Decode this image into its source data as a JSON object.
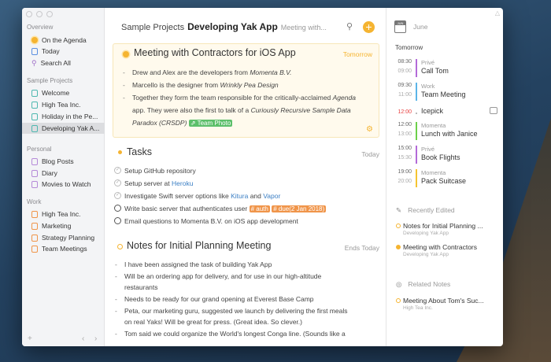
{
  "sidebar": {
    "overview": {
      "title": "Overview",
      "items": [
        {
          "label": "On the Agenda",
          "icon": "agenda-dot-icon"
        },
        {
          "label": "Today",
          "icon": "calendar-icon"
        },
        {
          "label": "Search All",
          "icon": "search-icon"
        }
      ]
    },
    "sample_projects": {
      "title": "Sample Projects",
      "items": [
        {
          "label": "Welcome"
        },
        {
          "label": "High Tea Inc."
        },
        {
          "label": "Holiday in the Pe..."
        },
        {
          "label": "Developing Yak A...",
          "selected": true
        }
      ]
    },
    "personal": {
      "title": "Personal",
      "items": [
        {
          "label": "Blog Posts"
        },
        {
          "label": "Diary"
        },
        {
          "label": "Movies to Watch"
        }
      ]
    },
    "work": {
      "title": "Work",
      "items": [
        {
          "label": "High Tea Inc."
        },
        {
          "label": "Marketing"
        },
        {
          "label": "Strategy Planning"
        },
        {
          "label": "Team Meetings"
        }
      ]
    },
    "footer": {
      "add": "+",
      "back": "‹",
      "forward": "›"
    }
  },
  "header": {
    "category": "Sample Projects",
    "project": "Developing Yak App",
    "note": "Meeting with..."
  },
  "meeting": {
    "title": "Meeting with Contractors for iOS App",
    "when": "Tomorrow",
    "b1": "Drew and Alex are the developers from ",
    "b1i": "Momenta B.V.",
    "b2": "Marcello is the designer from ",
    "b2i": "Wrinkly Pea Design",
    "b3a": "Together they form the team responsible for the critically-acclaimed ",
    "b3i": "Agenda",
    "b3b": "app. They were also the first to talk of a ",
    "b3i2": "Curiously Recursive Sample Data",
    "b3c": "Paradox (CRSDP)",
    "tag": "⇗ Team Photo"
  },
  "tasks": {
    "title": "Tasks",
    "when": "Today",
    "t1": "Setup GitHub repository",
    "t2": "Setup server at ",
    "t2l": "Heroku",
    "t3": "Investigate Swift server options like ",
    "t3l1": "Kitura",
    "t3m": " and ",
    "t3l2": "Vapor",
    "t4": "Write basic server that authenticates user ",
    "t4tag1": "# auth",
    "t4tag2": "# due(2 Jan 2018)",
    "t5": "Email questions to Momenta B.V. on iOS app development"
  },
  "notes": {
    "title": "Notes for Initial Planning Meeting",
    "when": "Ends Today",
    "b1": "I have been assigned the task of building Yak App",
    "b2": "Will be an ordering app for delivery, and for use in our high-altitude",
    "b2c": "restaurants",
    "b3": "Needs to be ready for our grand opening at Everest Base Camp",
    "b4": "Peta, our marketing guru, suggested we launch by delivering the first meals",
    "b4c": "on real Yaks! Will be great for press. (Great idea. So clever.)",
    "b5": "Tom said we could organize the World's longest Conga line. (Sounds like a"
  },
  "calendar": {
    "month": "June",
    "icon_label": "JUN",
    "day": "Tomorrow",
    "events": [
      {
        "start": "08:30",
        "end": "09:00",
        "calendar": "Privé",
        "name": "Call Tom",
        "color": "#b36ad8"
      },
      {
        "start": "09:30",
        "end": "11:00",
        "calendar": "Work",
        "name": "Team Meeting",
        "color": "#5bb5e8"
      },
      {
        "start": "12:00",
        "end": "",
        "calendar": "",
        "name": "Icepick",
        "color": "#e84040"
      },
      {
        "start": "12:00",
        "end": "13:00",
        "calendar": "Momenta",
        "name": "Lunch with Janice",
        "color": "#6cd04a"
      },
      {
        "start": "15:00",
        "end": "15:30",
        "calendar": "Privé",
        "name": "Book Flights",
        "color": "#b36ad8"
      },
      {
        "start": "19:00",
        "end": "20:00",
        "calendar": "Momenta",
        "name": "Pack Suitcase",
        "color": "#f5c431"
      }
    ]
  },
  "recent": {
    "title": "Recently Edited",
    "items": [
      {
        "name": "Notes for Initial Planning ...",
        "project": "Developing Yak App"
      },
      {
        "name": "Meeting with Contractors",
        "project": "Developing Yak App"
      }
    ]
  },
  "related": {
    "title": "Related Notes",
    "items": [
      {
        "name": "Meeting About Tom's Suc...",
        "project": "High Tea Inc."
      }
    ]
  },
  "colors": {
    "accent": "#f5b431",
    "tag_green": "#5cbf6a",
    "tag_orange": "#f0954a",
    "link": "#3b7fc4"
  }
}
